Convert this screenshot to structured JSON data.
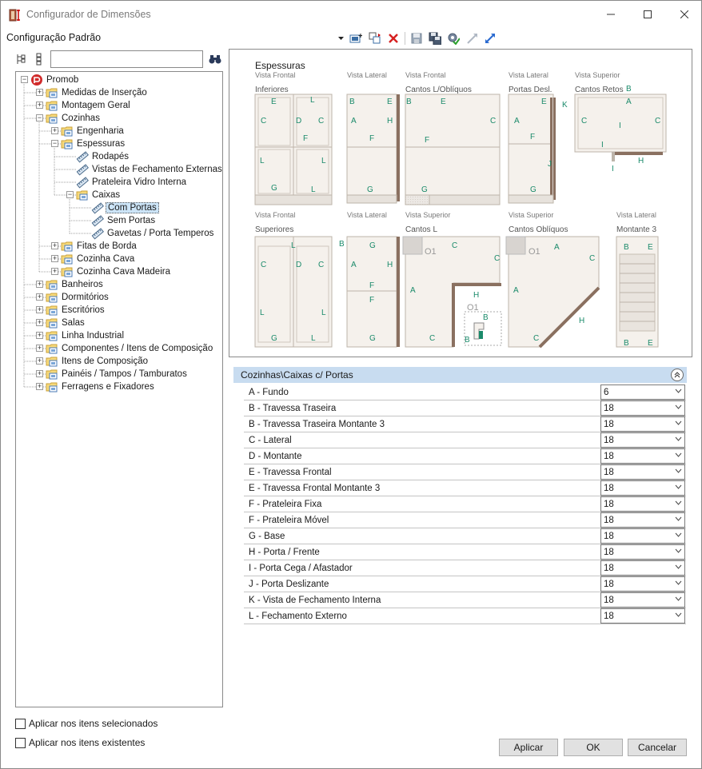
{
  "window": {
    "title": "Configurador de Dimensões",
    "minimize_glyph": "—",
    "maximize_glyph": "☐",
    "close_glyph": "✕"
  },
  "toolbar": {
    "config_label": "Configuração Padrão"
  },
  "search": {
    "value": "",
    "placeholder": ""
  },
  "tree": {
    "items": [
      {
        "label": "Promob",
        "depth": 0,
        "icon": "promob-logo-icon",
        "expander": "−"
      },
      {
        "label": "Medidas de Inserção",
        "depth": 1,
        "icon": "folder-icon",
        "expander": "+"
      },
      {
        "label": "Montagem Geral",
        "depth": 1,
        "icon": "folder-icon",
        "expander": "+"
      },
      {
        "label": "Cozinhas",
        "depth": 1,
        "icon": "folder-icon",
        "expander": "−"
      },
      {
        "label": "Engenharia",
        "depth": 2,
        "icon": "folder-icon",
        "expander": "+"
      },
      {
        "label": "Espessuras",
        "depth": 2,
        "icon": "folder-icon",
        "expander": "−"
      },
      {
        "label": "Rodapés",
        "depth": 3,
        "icon": "ruler-icon",
        "expander": ""
      },
      {
        "label": "Vistas de Fechamento Externas",
        "depth": 3,
        "icon": "ruler-icon",
        "expander": ""
      },
      {
        "label": "Prateleira Vidro Interna",
        "depth": 3,
        "icon": "ruler-icon",
        "expander": ""
      },
      {
        "label": "Caixas",
        "depth": 3,
        "icon": "folder-icon",
        "expander": "−"
      },
      {
        "label": "Com Portas",
        "depth": 4,
        "icon": "ruler-icon",
        "expander": "",
        "selected": true
      },
      {
        "label": "Sem Portas",
        "depth": 4,
        "icon": "ruler-icon",
        "expander": ""
      },
      {
        "label": "Gavetas / Porta Temperos",
        "depth": 4,
        "icon": "ruler-icon",
        "expander": ""
      },
      {
        "label": "Fitas de Borda",
        "depth": 2,
        "icon": "folder-icon",
        "expander": "+"
      },
      {
        "label": "Cozinha Cava",
        "depth": 2,
        "icon": "folder-icon",
        "expander": "+"
      },
      {
        "label": "Cozinha Cava Madeira",
        "depth": 2,
        "icon": "folder-icon",
        "expander": "+"
      },
      {
        "label": "Banheiros",
        "depth": 1,
        "icon": "folder-icon",
        "expander": "+"
      },
      {
        "label": "Dormitórios",
        "depth": 1,
        "icon": "folder-icon",
        "expander": "+"
      },
      {
        "label": "Escritórios",
        "depth": 1,
        "icon": "folder-icon",
        "expander": "+"
      },
      {
        "label": "Salas",
        "depth": 1,
        "icon": "folder-icon",
        "expander": "+"
      },
      {
        "label": "Linha Industrial",
        "depth": 1,
        "icon": "folder-icon",
        "expander": "+"
      },
      {
        "label": "Componentes / Itens de Composição",
        "depth": 1,
        "icon": "folder-icon",
        "expander": "+"
      },
      {
        "label": "Itens de Composição",
        "depth": 1,
        "icon": "folder-icon",
        "expander": "+"
      },
      {
        "label": "Painéis / Tampos / Tamburatos",
        "depth": 1,
        "icon": "folder-icon",
        "expander": "+"
      },
      {
        "label": "Ferragens e Fixadores",
        "depth": 1,
        "icon": "folder-icon",
        "expander": "+"
      }
    ]
  },
  "preview": {
    "title": "Espessuras",
    "panels": [
      {
        "view": "Vista Frontal",
        "subtitle": "Inferiores"
      },
      {
        "view": "Vista Lateral",
        "subtitle": ""
      },
      {
        "view": "Vista Frontal",
        "subtitle": "Cantos L/Oblíquos"
      },
      {
        "view": "Vista Lateral",
        "subtitle": "Portas Desl."
      },
      {
        "view": "Vista Superior",
        "subtitle": "Cantos Retos"
      },
      {
        "view": "Vista Frontal",
        "subtitle": "Superiores"
      },
      {
        "view": "Vista Lateral",
        "subtitle": ""
      },
      {
        "view": "Vista Superior",
        "subtitle": "Cantos L"
      },
      {
        "view": "Vista Superior",
        "subtitle": "Cantos Oblíquos"
      },
      {
        "view": "Vista Lateral",
        "subtitle": "Montante 3"
      }
    ],
    "marker_label": "O1",
    "letters": {
      "A": "A",
      "B": "B",
      "C": "C",
      "D": "D",
      "E": "E",
      "F": "F",
      "G": "G",
      "H": "H",
      "I": "I",
      "J": "J",
      "K": "K",
      "L": "L"
    }
  },
  "properties": {
    "path": "Cozinhas\\Caixas c/ Portas",
    "rows": [
      {
        "name": "A - Fundo",
        "value": "6"
      },
      {
        "name": "B - Travessa Traseira",
        "value": "18"
      },
      {
        "name": "B - Travessa Traseira Montante 3",
        "value": "18"
      },
      {
        "name": "C - Lateral",
        "value": "18"
      },
      {
        "name": "D - Montante",
        "value": "18"
      },
      {
        "name": "E - Travessa Frontal",
        "value": "18"
      },
      {
        "name": "E - Travessa Frontal Montante 3",
        "value": "18"
      },
      {
        "name": "F - Prateleira Fixa",
        "value": "18"
      },
      {
        "name": "F - Prateleira Móvel",
        "value": "18"
      },
      {
        "name": "G - Base",
        "value": "18"
      },
      {
        "name": "H - Porta / Frente",
        "value": "18"
      },
      {
        "name": "I - Porta Cega / Afastador",
        "value": "18"
      },
      {
        "name": "J - Porta Deslizante",
        "value": "18"
      },
      {
        "name": "K - Vista de Fechamento Interna",
        "value": "18"
      },
      {
        "name": "L - Fechamento Externo",
        "value": "18"
      }
    ]
  },
  "options": {
    "apply_selected": "Aplicar nos itens selecionados",
    "apply_existing": "Aplicar nos itens existentes"
  },
  "buttons": {
    "apply": "Aplicar",
    "ok": "OK",
    "cancel": "Cancelar"
  },
  "colors": {
    "accent_green": "#1a8a6a",
    "panel_fill": "#f5f1ec",
    "panel_stroke": "#bdb4aa",
    "door_brown": "#8a7060",
    "header_blue": "#c8dcf0"
  }
}
